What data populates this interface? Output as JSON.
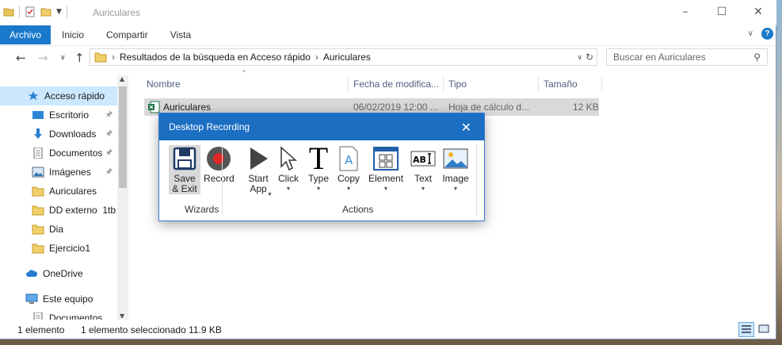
{
  "window": {
    "title": "Auriculares"
  },
  "ribbon": {
    "tabs": [
      {
        "label": "Archivo"
      },
      {
        "label": "Inicio"
      },
      {
        "label": "Compartir"
      },
      {
        "label": "Vista"
      }
    ]
  },
  "address": {
    "breadcrumb": [
      "Resultados de la búsqueda en Acceso rápido",
      "Auriculares"
    ],
    "search_placeholder": "Buscar en Auriculares"
  },
  "sidebar": {
    "items": [
      {
        "label": "Acceso rápido",
        "icon": "star-icon",
        "pinned": false
      },
      {
        "label": "Escritorio",
        "icon": "desktop-icon",
        "pinned": true
      },
      {
        "label": "Downloads",
        "icon": "download-icon",
        "pinned": true
      },
      {
        "label": "Documentos",
        "icon": "document-icon",
        "pinned": true
      },
      {
        "label": "Imágenes",
        "icon": "pictures-icon",
        "pinned": true
      },
      {
        "label": "Auriculares",
        "icon": "folder-icon",
        "pinned": false
      },
      {
        "label": "DD externo  1tb",
        "icon": "folder-icon",
        "pinned": false
      },
      {
        "label": "Dia",
        "icon": "folder-icon",
        "pinned": false
      },
      {
        "label": "Ejercicio1",
        "icon": "folder-icon",
        "pinned": false
      },
      {
        "label": "OneDrive",
        "icon": "cloud-icon",
        "pinned": false
      },
      {
        "label": "Este equipo",
        "icon": "computer-icon",
        "pinned": false
      },
      {
        "label": "Documentos",
        "icon": "document-icon",
        "pinned": false
      }
    ]
  },
  "columns": [
    "Nombre",
    "Fecha de modifica...",
    "Tipo",
    "Tamaño"
  ],
  "files": [
    {
      "name": "Auriculares",
      "date": "06/02/2019 12:00 ...",
      "type": "Hoja de cálculo d...",
      "size": "12 KB"
    }
  ],
  "status": {
    "count": "1 elemento",
    "selection": "1 elemento seleccionado  11.9 KB"
  },
  "dialog": {
    "title": "Desktop Recording",
    "wizards_label": "Wizards",
    "actions_label": "Actions",
    "tools": {
      "save": "Save\n& Exit",
      "record": "Record",
      "start_app": "Start\nApp",
      "click": "Click",
      "type": "Type",
      "copy": "Copy",
      "element": "Element",
      "text": "Text",
      "image": "Image"
    }
  },
  "colors": {
    "accent": "#1979ca",
    "dialog_title_bg": "#1b6ec2",
    "selection_bg": "#cce8ff",
    "record_red": "#e02828"
  }
}
